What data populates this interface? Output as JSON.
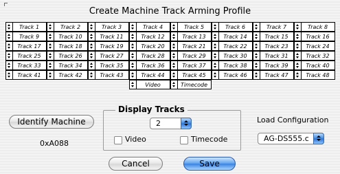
{
  "dialog": {
    "title": "Create Machine Track Arming Profile"
  },
  "tracks": {
    "rows": [
      [
        "Track 1",
        "Track 2",
        "Track 3",
        "Track 4",
        "Track 5",
        "Track 6",
        "Track 7",
        "Track 8"
      ],
      [
        "Track 9",
        "Track 10",
        "Track 11",
        "Track 12",
        "Track 13",
        "Track 14",
        "Track 15",
        "Track 16"
      ],
      [
        "Track 17",
        "Track 18",
        "Track 19",
        "Track 20",
        "Track 21",
        "Track 22",
        "Track 23",
        "Track 24"
      ],
      [
        "Track 25",
        "Track 26",
        "Track 27",
        "Track 28",
        "Track 29",
        "Track 30",
        "Track 31",
        "Track 32"
      ],
      [
        "Track 33",
        "Track 34",
        "Track 35",
        "Track 36",
        "Track 37",
        "Track 38",
        "Track 39",
        "Track 40"
      ],
      [
        "Track 41",
        "Track 42",
        "Track 43",
        "Track 44",
        "Track 45",
        "Track 46",
        "Track 47",
        "Track 48"
      ]
    ],
    "extra": [
      "Video",
      "Timecode"
    ]
  },
  "identify": {
    "button_label": "Identify Machine",
    "machine_id": "0xA088"
  },
  "display_tracks": {
    "title": "Display Tracks",
    "selected": "2",
    "video_label": "Video",
    "timecode_label": "Timecode"
  },
  "load_config": {
    "label": "Load Configuration",
    "selected": "AG-DS555.c"
  },
  "buttons": {
    "cancel": "Cancel",
    "save": "Save"
  }
}
